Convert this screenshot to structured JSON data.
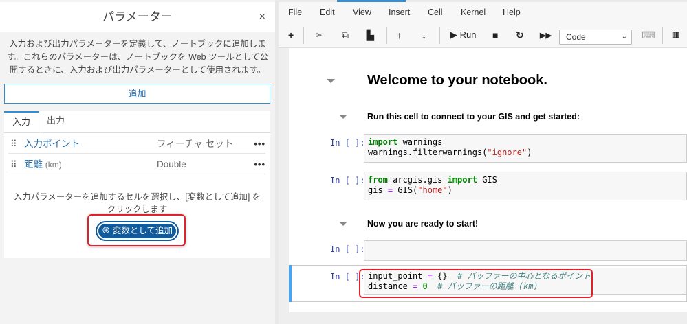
{
  "panel": {
    "title": "パラメーター",
    "close": "×",
    "description": "入力および出力パラメーターを定義して、ノートブックに追加します。これらのパラメーターは、ノートブックを Web ツールとして公開するときに、入力および出力パラメーターとして使用されます。",
    "add_button": "追加",
    "tabs": [
      "入力",
      "出力"
    ],
    "params": [
      {
        "name": "入力ポイント",
        "unit": "",
        "type": "フィーチャ セット"
      },
      {
        "name": "距離",
        "unit": "(km)",
        "type": "Double"
      }
    ],
    "more": "•••",
    "grip": "⠿",
    "hint": "入力パラメーターを追加するセルを選択し、[変数として追加] をクリックします",
    "add_variable_button": "変数として追加",
    "add_variable_icon": "⊕"
  },
  "menu": [
    "File",
    "Edit",
    "View",
    "Insert",
    "Cell",
    "Kernel",
    "Help"
  ],
  "toolbar": {
    "run": "Run",
    "cell_type": "Code"
  },
  "notebook": {
    "heading": "Welcome to your notebook.",
    "sub1": "Run this cell to connect to your GIS and get started:",
    "sub2": "Now you are ready to start!",
    "prompt": "In [ ]:",
    "cell1": {
      "l1a": "import",
      "l1b": " warnings",
      "l2a": "warnings.filterwarnings(",
      "l2b": "\"ignore\"",
      "l2c": ")"
    },
    "cell2": {
      "a": "from",
      "b": " arcgis.gis ",
      "c": "import",
      "d": " GIS",
      "e": "gis ",
      "f": "=",
      "g": " GIS(",
      "h": "\"home\"",
      "i": ")"
    },
    "cell4": {
      "a": "input_point ",
      "b": "=",
      "c": " {}  ",
      "d": "# バッファーの中心となるポイント",
      "e": "distance ",
      "f": "=",
      "g": " ",
      "h": "0",
      "i": "  ",
      "j": "# バッファーの距離 (km)"
    }
  }
}
